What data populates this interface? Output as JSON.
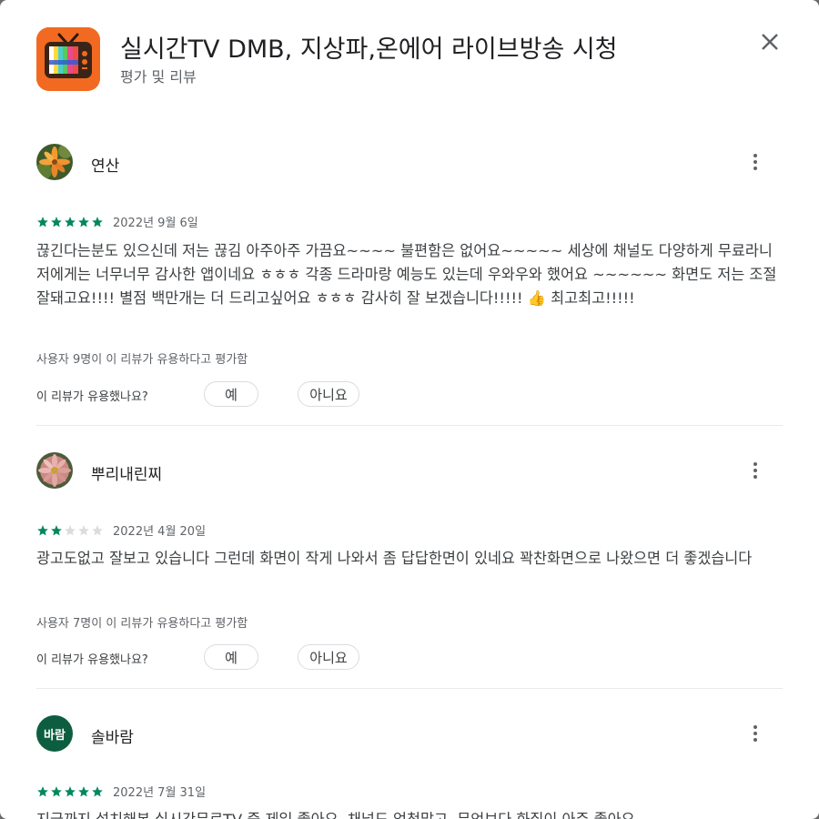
{
  "app": {
    "title": "실시간TV DMB, 지상파,온에어 라이브방송 시청",
    "subtitle": "평가 및 리뷰",
    "icon": "tv-app-icon"
  },
  "colors": {
    "star_filled": "#01875f",
    "star_empty": "#dadce0",
    "avatar_text_bg": "#0d5e40"
  },
  "reviews": [
    {
      "author": "연산",
      "avatar": "flower-photo",
      "rating": 5,
      "date": "2022년 9월 6일",
      "text": "끊긴다는분도 있으신데 저는 끊김 아주아주 가끔요~~~~ 불편함은 없어요~~~~~ 세상에 채널도 다양하게 무료라니 저에게는 너무너무 감사한 앱이네요 ㅎㅎㅎ 각종 드라마랑 예능도 있는데 우와우와 했어요 ~~~~~~ 화면도 저는 조절잘돼고요!!!! 별점 백만개는 더 드리고싶어요 ㅎㅎㅎ 감사히 잘 보겠습니다!!!!! 👍 최고최고!!!!!",
      "helpful_count": "사용자 9명이 이 리뷰가 유용하다고 평가함",
      "helpful_question": "이 리뷰가 유용했나요?",
      "yes": "예",
      "no": "아니요"
    },
    {
      "author": "뿌리내린찌",
      "avatar": "flower-photo",
      "rating": 2,
      "date": "2022년 4월 20일",
      "text": "광고도없고 잘보고 있습니다 그런데 화면이 작게 나와서 좀 답답한면이 있네요 꽉찬화면으로 나왔으면 더 좋겠습니다",
      "helpful_count": "사용자 7명이 이 리뷰가 유용하다고 평가함",
      "helpful_question": "이 리뷰가 유용했나요?",
      "yes": "예",
      "no": "아니요"
    },
    {
      "author": "솔바람",
      "avatar_text": "바람",
      "rating": 5,
      "date": "2022년 7월 31일",
      "text": "지금까지 설치해본 실시간무료TV 중 제일 좋아요. 채널도 엄청많고, 무엇보다 화질이 아주 좋아요."
    }
  ]
}
